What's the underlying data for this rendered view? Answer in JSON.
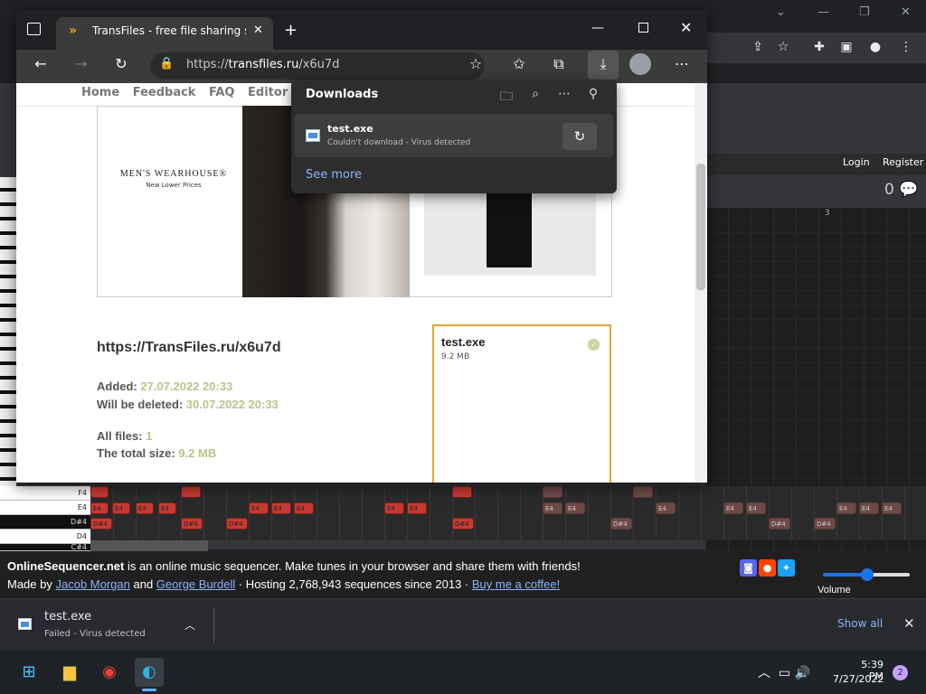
{
  "edge": {
    "tab_title": "TransFiles - free file sharing servic",
    "address_protocol": "https://",
    "address_host": "transfiles.ru",
    "address_path": "/x6u7d"
  },
  "site": {
    "nav": [
      "Home",
      "Feedback",
      "FAQ",
      "Editor"
    ],
    "ad_brand": "MEN'S WEARHOUSE®",
    "ad_sub": "New Lower Prices",
    "url_heading": "https://TransFiles.ru/x6u7d",
    "added_label": "Added:",
    "added_value": "27.07.2022 20:33",
    "deleted_label": "Will be deleted:",
    "deleted_value": "30.07.2022 20:33",
    "allfiles_label": "All files:",
    "allfiles_value": "1",
    "totalsize_label": "The total size:",
    "totalsize_value": "9.2 MB",
    "file_name": "test.exe",
    "file_size": "9.2 MB"
  },
  "flyout": {
    "title": "Downloads",
    "item_name": "test.exe",
    "item_status": "Couldn't download - Virus detected",
    "see_more": "See more"
  },
  "sequencer": {
    "login": "Login",
    "register": "Register",
    "comment_count": "0",
    "bar_number": "3",
    "keys": [
      "F4",
      "E4",
      "D#4",
      "D4",
      "C#4"
    ],
    "note_label": "E4",
    "note_label_sharp": "D#4",
    "footer_brand": "OnlineSequencer.net",
    "footer_text1": " is an online music sequencer. Make tunes in your browser and share them with friends!",
    "footer_madeby": "Made by ",
    "author1": "Jacob Morgan",
    "and": " and ",
    "author2": "George Burdell",
    "hosting": " · Hosting 2,768,943 sequences since 2013 · ",
    "coffee": "Buy me a coffee!",
    "volume": "Volume"
  },
  "chrome_download_bar": {
    "file_name": "test.exe",
    "status": "Failed - Virus detected",
    "show_all": "Show all"
  },
  "taskbar": {
    "time": "5:39 PM",
    "date": "7/27/2022",
    "notifications": "2"
  }
}
